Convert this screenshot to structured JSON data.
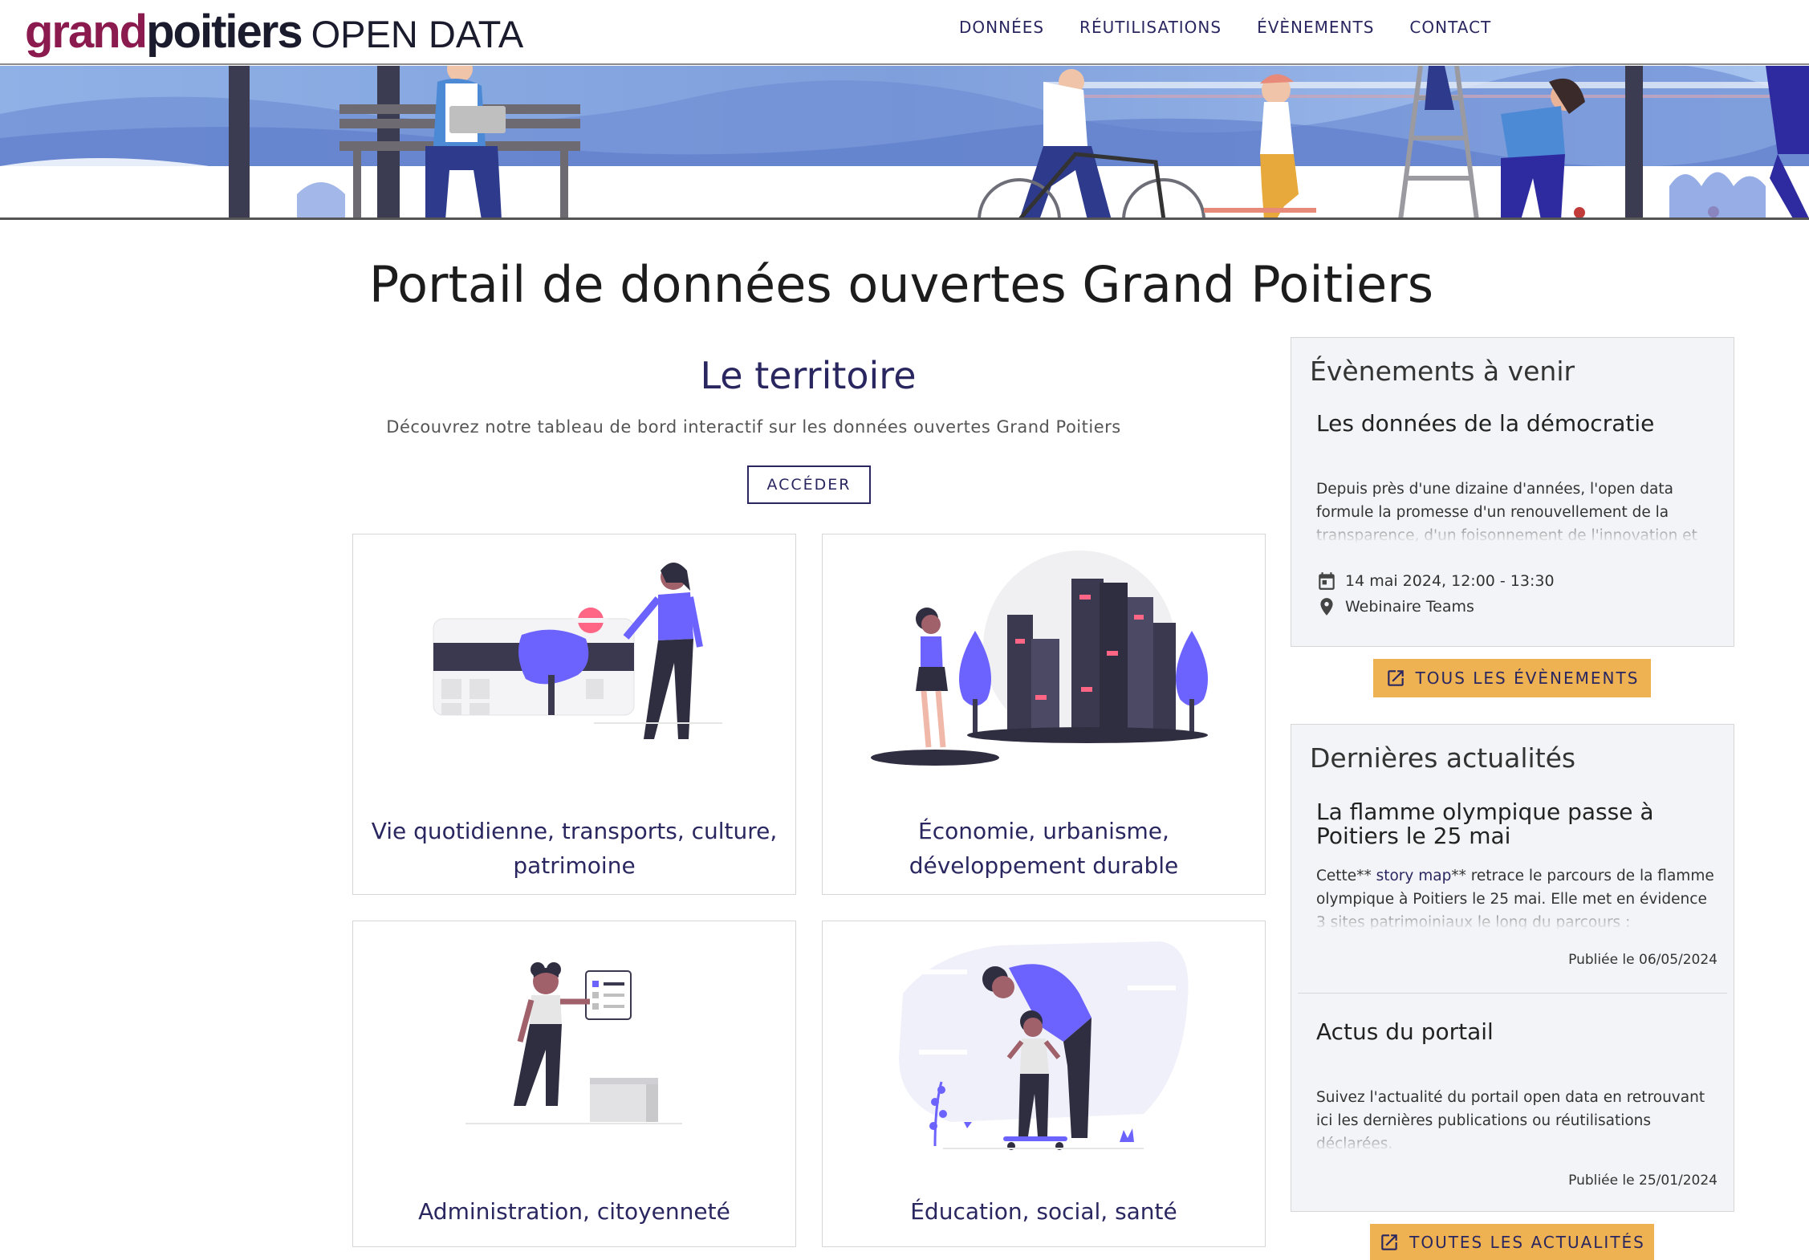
{
  "header": {
    "logo_part1": "grand",
    "logo_part2": "poitiers",
    "logo_part3": "OPEN DATA",
    "nav": [
      "DONNÉES",
      "RÉUTILISATIONS",
      "ÉVÈNEMENTS",
      "CONTACT"
    ]
  },
  "page_title": "Portail de données ouvertes Grand Poitiers",
  "territoire": {
    "title": "Le territoire",
    "description": "Découvrez notre tableau de bord interactif sur les données ouvertes Grand Poitiers",
    "button": "ACCÉDER"
  },
  "cards": [
    {
      "line1": "Vie quotidienne, transports, culture,",
      "line2": "patrimoine"
    },
    {
      "line1": "Économie, urbanisme,",
      "line2": "développement durable"
    },
    {
      "line1": "Administration, citoyenneté",
      "line2": ""
    },
    {
      "line1": "Éducation, social, santé",
      "line2": ""
    }
  ],
  "events": {
    "heading": "Évènements à venir",
    "item_title": "Les données de la démocratie",
    "item_text": "Depuis près d'une dizaine d'années, l'open data formule la promesse d'un renouvellement de la transparence, d'un foisonnement de l'innovation et",
    "date": "14 mai 2024, 12:00 - 13:30",
    "location": "Webinaire Teams",
    "all_button": "TOUS LES ÉVÈNEMENTS"
  },
  "news": {
    "heading": "Dernières actualités",
    "items": [
      {
        "title": "La flamme olympique passe à Poitiers le 25 mai",
        "text_before": "Cette** ",
        "text_link": "story map",
        "text_after": "** retrace le parcours de la flamme olympique à Poitiers le 25 mai. Elle met en évidence 3 sites patrimoiniaux le long du parcours :",
        "published": "Publiée le 06/05/2024"
      },
      {
        "title": "Actus du portail",
        "text": "Suivez l'actualité du portail open data en retrouvant ici les dernières publications ou réutilisations déclarées.",
        "published": "Publiée le 25/01/2024"
      }
    ],
    "all_button": "TOUTES LES ACTUALITÉS"
  },
  "colors": {
    "brand_purple": "#8b1a4f",
    "navy": "#2a2760",
    "accent_violet": "#6c63ff",
    "button_yellow": "#efb252",
    "panel_bg": "#f3f4f7"
  }
}
